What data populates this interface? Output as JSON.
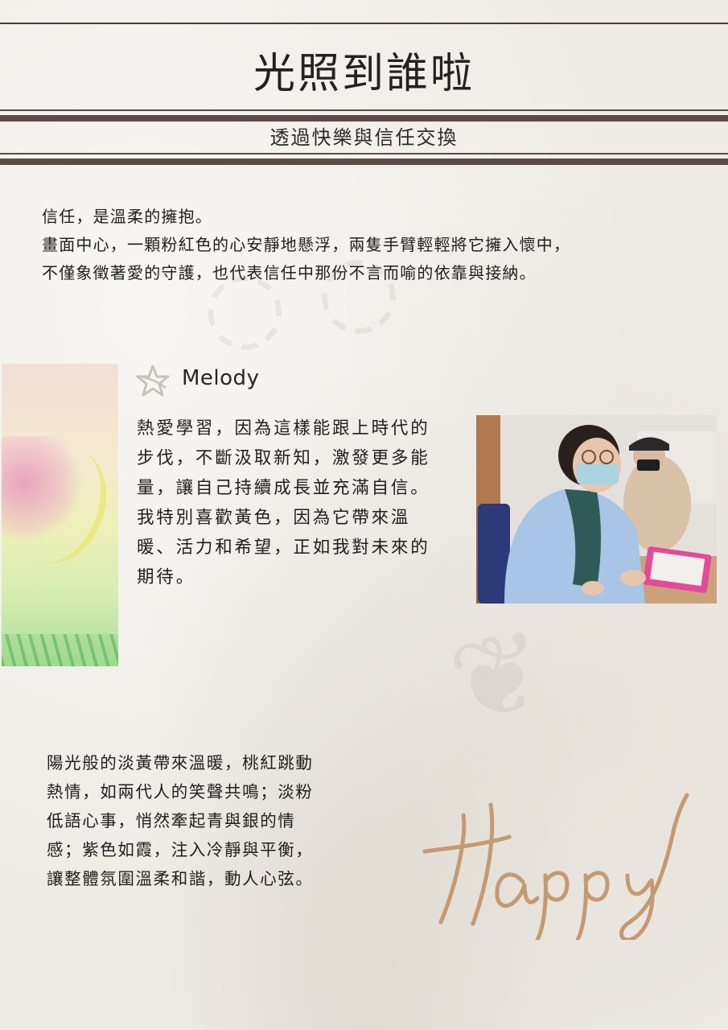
{
  "page": {
    "title": "光照到誰啦",
    "subtitle": "透過快樂與信任交換"
  },
  "intro": {
    "lines": [
      "信任，是溫柔的擁抱。",
      "畫面中心，一顆粉紅色的心安靜地懸浮，兩隻手臂輕輕將它擁入懷中，",
      "不僅象徵著愛的守護，也代表信任中那份不言而喻的依靠與接納。"
    ]
  },
  "profile": {
    "icon": "star-icon",
    "name": "Melody",
    "lines": [
      "熱愛學習，因為這樣能跟上時代的",
      "步伐，不斷汲取新知，激發更多能",
      "量，讓自己持續成長並充滿自信。",
      "我特別喜歡黃色，因為它帶來溫",
      "暖、活力和希望，正如我對未來的",
      "期待。"
    ]
  },
  "poem": {
    "lines": [
      "陽光般的淡黃帶來溫暖，桃紅跳動",
      "熱情，如兩代人的笑聲共鳴；淡粉",
      "低語心事，悄然牽起青與銀的情",
      "感；紫色如霞，注入冷靜與平衡，",
      "讓整體氛圍溫柔和諧，動人心弦。"
    ]
  },
  "decoration": {
    "script_word": "Happy"
  },
  "colors": {
    "background": "#efece6",
    "rule": "#5a4c44",
    "script_accent": "#c49a72",
    "star_accent": "#c8c2b8"
  }
}
